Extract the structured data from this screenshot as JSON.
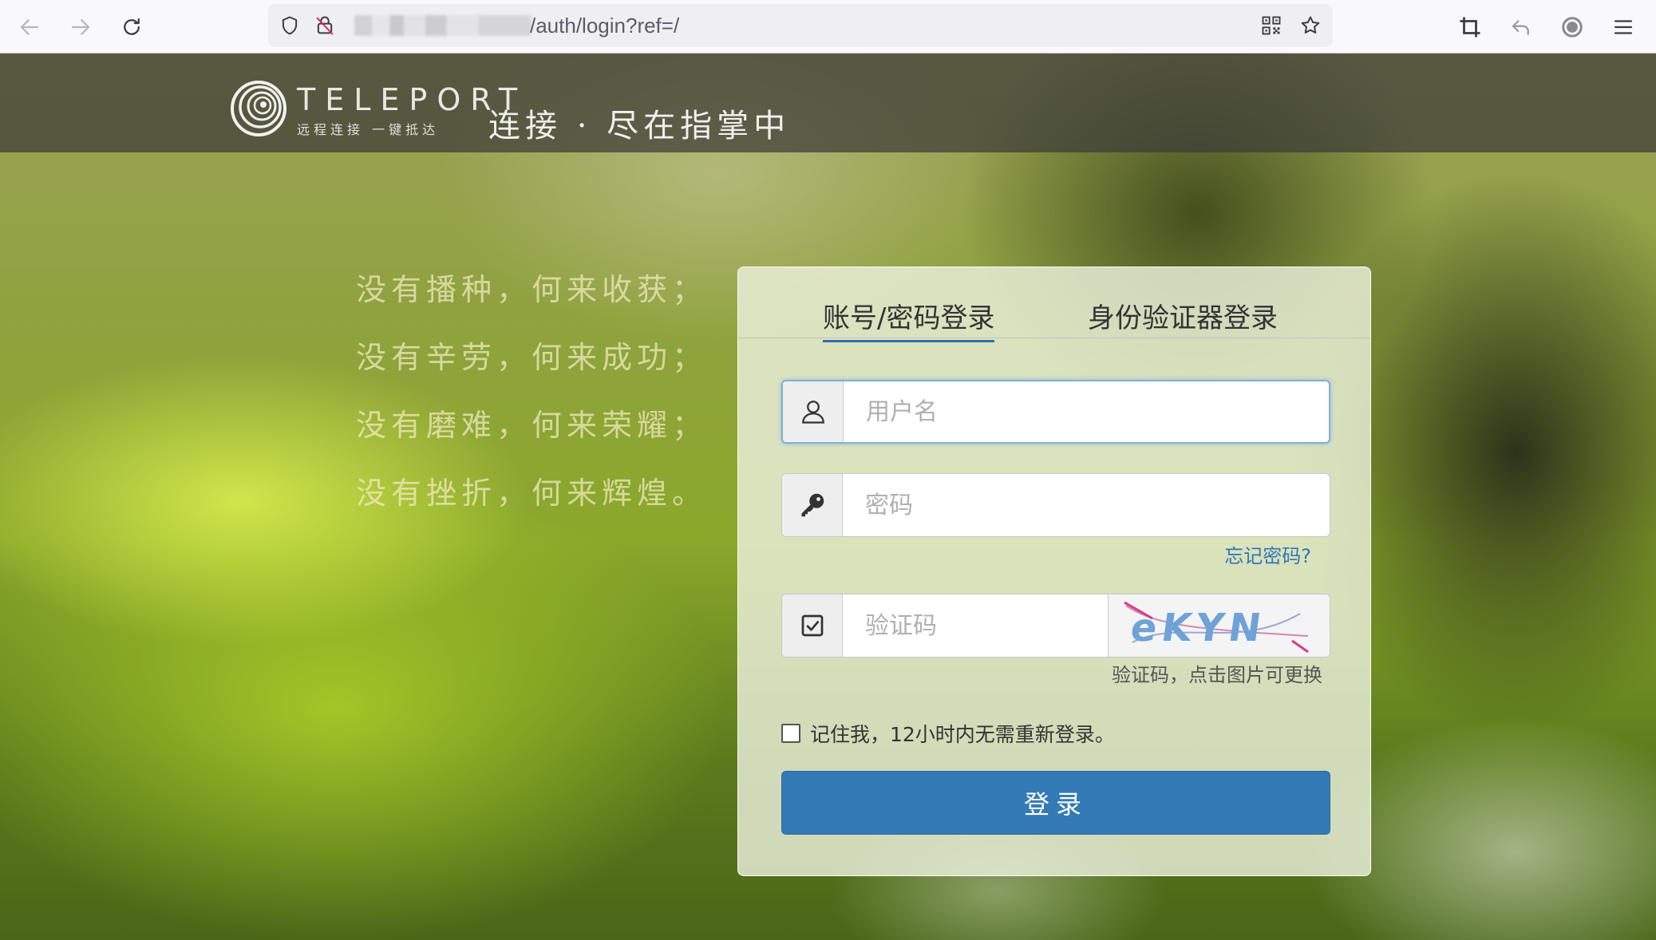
{
  "browser": {
    "url_text": "/auth/login?ref=/",
    "icons": [
      "back-icon",
      "forward-icon",
      "reload-icon",
      "shield-icon",
      "lock-slash-icon",
      "qr-code-icon",
      "star-icon",
      "crop-icon",
      "undo-icon",
      "extension-icon",
      "menu-icon"
    ]
  },
  "header": {
    "logo_word": "TELEPORT",
    "logo_sub": "远程连接 一键抵达",
    "slogan": "连接 · 尽在指掌中"
  },
  "poem": {
    "lines": [
      "没有播种，何来收获；",
      "没有辛劳，何来成功；",
      "没有磨难，何来荣耀；",
      "没有挫折，何来辉煌。"
    ]
  },
  "login": {
    "tabs": [
      {
        "label": "账号/密码登录",
        "active": true
      },
      {
        "label": "身份验证器登录",
        "active": false
      }
    ],
    "username_placeholder": "用户名",
    "password_placeholder": "密码",
    "forgot_label": "忘记密码?",
    "captcha_placeholder": "验证码",
    "captcha_text": "eKYN",
    "captcha_hint": "验证码，点击图片可更换",
    "remember_label": "记住我，12小时内无需重新登录。",
    "submit_label": "登录"
  },
  "colors": {
    "accent": "#337ab7",
    "link": "#2f77b8",
    "focus_border": "#7fb0e0"
  }
}
